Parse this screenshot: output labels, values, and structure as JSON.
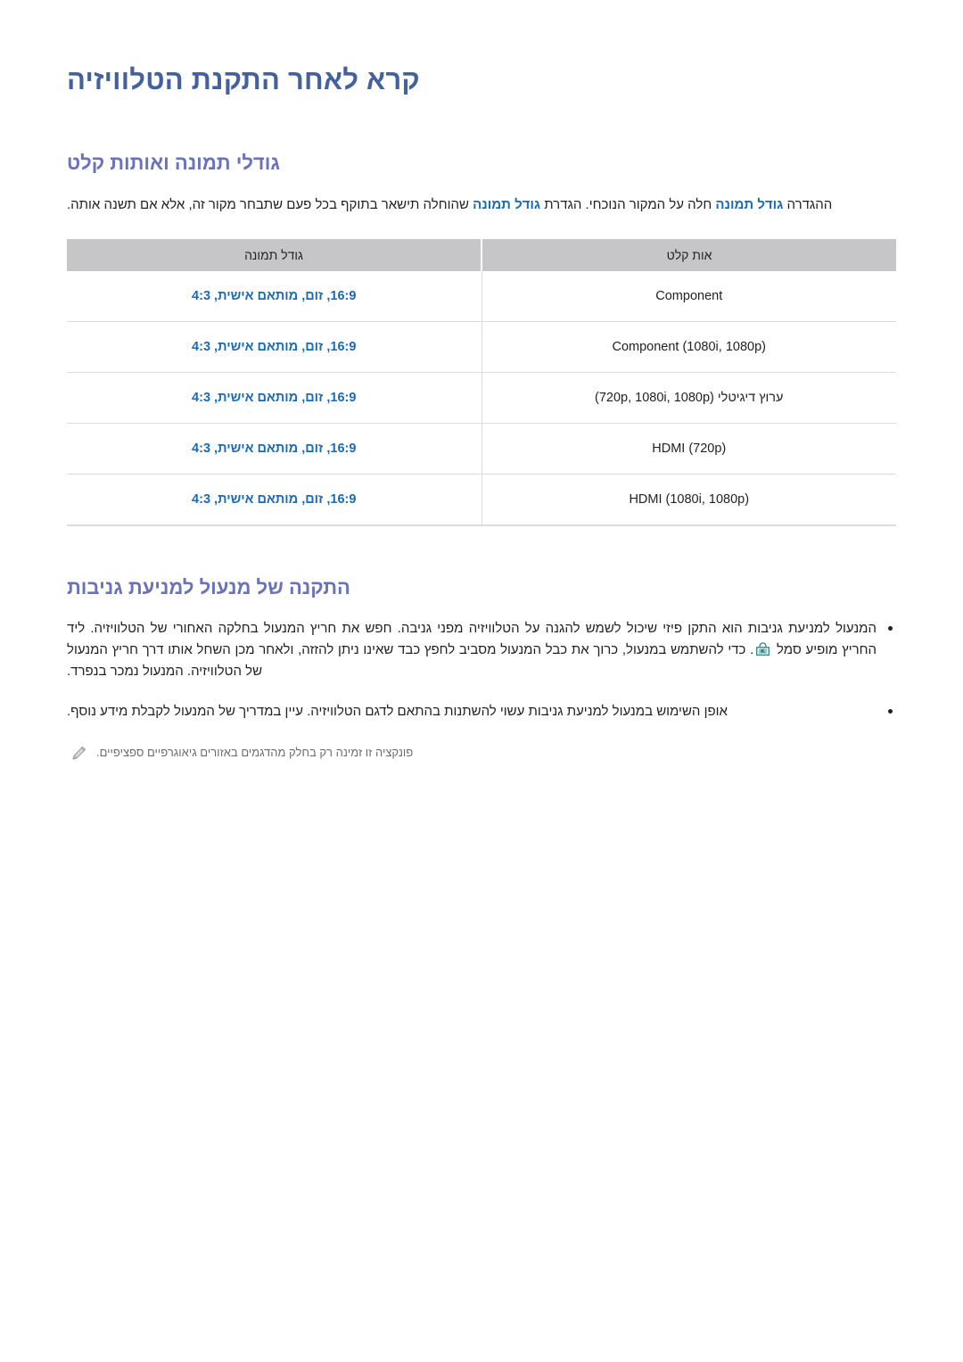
{
  "document": {
    "title": "קרא לאחר התקנת הטלוויזיה",
    "title_color": "#44619d"
  },
  "sections": [
    {
      "heading": "גודלי תמונה ואותות קלט",
      "heading_color": "#6a72b8",
      "intro": {
        "part1": "ההגדרה ",
        "highlight1": "גודל תמונה",
        "part2": " חלה על המקור הנוכחי. הגדרת ",
        "highlight2": "גודל תמונה",
        "part3": " שהוחלה תישאר בתוקף בכל פעם שתבחר מקור זה, אלא אם תשנה אותה.",
        "highlight_color": "#1a6ab5"
      },
      "table": {
        "headers": {
          "signal": "אות קלט",
          "picture_size": "גודל תמונה"
        },
        "rows": [
          {
            "signal": "Component",
            "picture_size": "16:9, זום, מותאם אישית, 4:3"
          },
          {
            "signal": "Component (1080i, 1080p)",
            "picture_size": "16:9, זום, מותאם אישית, 4:3"
          },
          {
            "signal": "ערוץ דיגיטלי (720p, 1080i, 1080p)",
            "picture_size": "16:9, זום, מותאם אישית, 4:3"
          },
          {
            "signal": "HDMI (720p)",
            "picture_size": "16:9, זום, מותאם אישית, 4:3"
          },
          {
            "signal": "HDMI (1080i, 1080p)",
            "picture_size": "16:9, זום, מותאם אישית, 4:3"
          }
        ]
      }
    },
    {
      "heading": "התקנה של מנעול למניעת גניבות",
      "heading_color": "#6a72b8",
      "bullets": [
        {
          "text_before_icon": "המנעול למניעת גניבות הוא התקן פיזי שיכול לשמש להגנה על הטלוויזיה מפני גניבה. חפש את חריץ המנעול בחלקה האחורי של הטלוויזיה. ליד החריץ מופיע סמל ",
          "icon": "kensington-lock-icon",
          "text_after_icon": ". כדי להשתמש במנעול, כרוך את כבל המנעול מסביב לחפץ כבד שאינו ניתן להזזה, ולאחר מכן השחל אותו דרך חריץ המנעול של הטלוויזיה. המנעול נמכר בנפרד."
        },
        {
          "text": "אופן השימוש במנעול למניעת גניבות עשוי להשתנות בהתאם לדגם הטלוויזיה. עיין במדריך של המנעול לקבלת מידע נוסף."
        }
      ],
      "note": {
        "icon": "pencil-icon",
        "text": "פונקציה זו זמינה רק בחלק מהדגמים באזורים גיאוגרפיים ספציפיים.",
        "color": "#6d6e71"
      }
    }
  ]
}
